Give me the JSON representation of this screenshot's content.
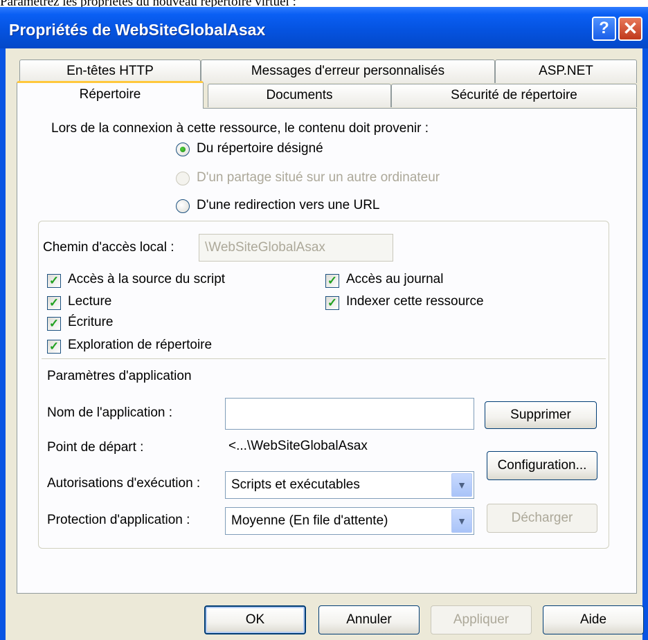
{
  "caption": "Paramétrez les propriétés du nouveau répertoire virtuel :",
  "window": {
    "title": "Propriétés de WebSiteGlobalAsax",
    "help_glyph": "?",
    "close_glyph": "✕"
  },
  "tabs": {
    "row1": [
      "En-têtes HTTP",
      "Messages d'erreur personnalisés",
      "ASP.NET"
    ],
    "row2": [
      "Répertoire",
      "Documents",
      "Sécurité de répertoire"
    ],
    "active": "Répertoire"
  },
  "content_source": {
    "prompt": "Lors de la connexion à cette ressource, le contenu doit provenir :",
    "options": [
      {
        "label": "Du répertoire désigné",
        "checked": true,
        "enabled": true
      },
      {
        "label": "D'un partage situé sur un autre ordinateur",
        "checked": false,
        "enabled": false
      },
      {
        "label": "D'une redirection vers une URL",
        "checked": false,
        "enabled": true
      }
    ]
  },
  "local_path": {
    "label": "Chemin d'accès local :",
    "value": "\\WebSiteGlobalAsax"
  },
  "permissions": {
    "script_source": {
      "label": "Accès à la source du script",
      "checked": true
    },
    "read": {
      "label": "Lecture",
      "checked": true
    },
    "write": {
      "label": "Écriture",
      "checked": true
    },
    "browse": {
      "label": "Exploration de répertoire",
      "checked": true
    },
    "log": {
      "label": "Accès au journal",
      "checked": true
    },
    "index": {
      "label": "Indexer cette ressource",
      "checked": true
    }
  },
  "app_settings": {
    "heading": "Paramètres d'application",
    "app_name_label": "Nom de l'application :",
    "app_name_value": "",
    "start_point_label": "Point de départ :",
    "start_point_value": "<...\\WebSiteGlobalAsax",
    "exec_perms_label": "Autorisations d'exécution :",
    "exec_perms_value": "Scripts et exécutables",
    "protection_label": "Protection d'application :",
    "protection_value": "Moyenne (En file d'attente)",
    "remove_button": "Supprimer",
    "config_button": "Configuration...",
    "unload_button": "Décharger"
  },
  "footer": {
    "ok": "OK",
    "cancel": "Annuler",
    "apply": "Appliquer",
    "help": "Aide"
  },
  "colors": {
    "title_blue": "#0553e0",
    "face": "#ece9d8",
    "tab_highlight": "#ffc83c",
    "check_green": "#21a121"
  }
}
